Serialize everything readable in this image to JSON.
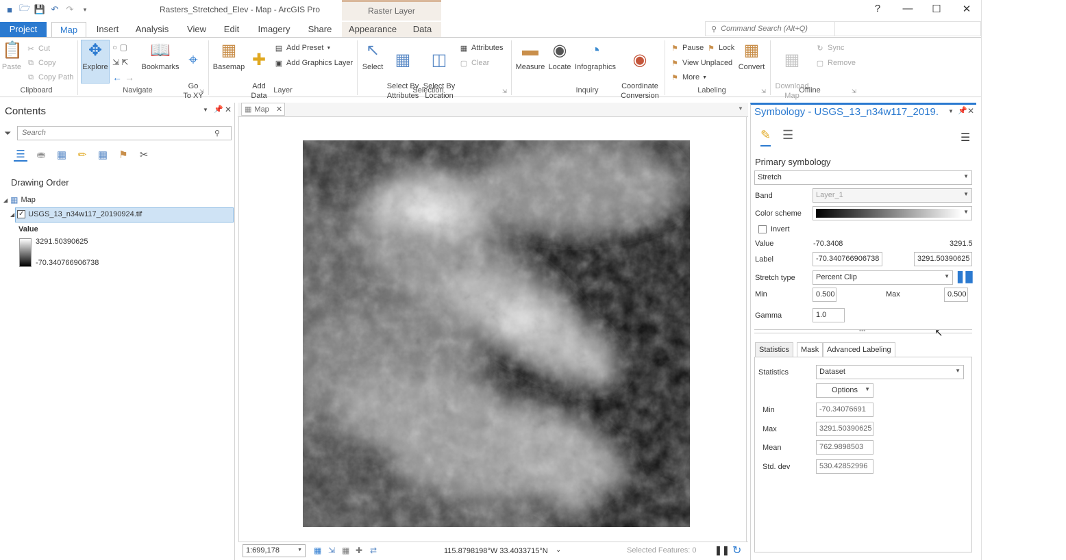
{
  "app": {
    "title": "Rasters_Stretched_Elev - Map - ArcGIS Pro",
    "context_tab_header": "Raster Layer",
    "help": "?",
    "command_search_placeholder": "Command Search (Alt+Q)"
  },
  "tabs": [
    "Project",
    "Map",
    "Insert",
    "Analysis",
    "View",
    "Edit",
    "Imagery",
    "Share",
    "Appearance",
    "Data"
  ],
  "ribbon": {
    "clipboard": {
      "label": "Clipboard",
      "paste": "Paste",
      "cut": "Cut",
      "copy": "Copy",
      "copy_path": "Copy Path"
    },
    "navigate": {
      "label": "Navigate",
      "explore": "Explore",
      "bookmarks": "Bookmarks",
      "go_to_xy": "Go\nTo XY"
    },
    "layer": {
      "label": "Layer",
      "basemap": "Basemap",
      "add_data": "Add\nData",
      "add_preset": "Add Preset",
      "add_graphics_layer": "Add Graphics Layer"
    },
    "selection": {
      "label": "Selection",
      "select": "Select",
      "select_by_attributes": "Select By\nAttributes",
      "select_by_location": "Select By\nLocation",
      "attributes": "Attributes",
      "clear": "Clear"
    },
    "inquiry": {
      "label": "Inquiry",
      "measure": "Measure",
      "locate": "Locate",
      "infographics": "Infographics",
      "coordinate_conversion": "Coordinate\nConversion"
    },
    "labeling": {
      "label": "Labeling",
      "pause": "Pause",
      "lock": "Lock",
      "view_unplaced": "View Unplaced",
      "more": "More",
      "convert": "Convert"
    },
    "offline": {
      "label": "Offline",
      "download_map": "Download\nMap",
      "sync": "Sync",
      "remove": "Remove"
    }
  },
  "contents": {
    "title": "Contents",
    "search_placeholder": "Search",
    "drawing_order": "Drawing Order",
    "map_name": "Map",
    "layer_name": "USGS_13_n34w117_20190924.tif",
    "legend_title": "Value",
    "legend_high": "3291.50390625",
    "legend_low": "-70.340766906738"
  },
  "map_view": {
    "tab_label": "Map",
    "scale": "1:699,178",
    "coordinates": "115.8798198°W 33.4033715°N",
    "selected_features": "Selected Features: 0"
  },
  "symbology": {
    "title": "Symbology - USGS_13_n34w117_2019...",
    "primary_symbology": "Primary symbology",
    "renderer": "Stretch",
    "band_label": "Band",
    "band_value": "Layer_1",
    "color_scheme_label": "Color scheme",
    "invert_label": "Invert",
    "value_label": "Value",
    "value_min": "-70.3408",
    "value_max": "3291.5",
    "label_label": "Label",
    "label_min": "-70.340766906738",
    "label_max": "3291.50390625",
    "stretch_type_label": "Stretch type",
    "stretch_type": "Percent Clip",
    "min_label": "Min",
    "min_value": "0.500",
    "max_label": "Max",
    "max_value": "0.500",
    "gamma_label": "Gamma",
    "gamma_value": "1.0",
    "tabs": [
      "Statistics",
      "Mask",
      "Advanced Labeling"
    ],
    "statistics_label": "Statistics",
    "statistics_value": "Dataset",
    "options_label": "Options",
    "stats": {
      "min_label": "Min",
      "min": "-70.34076691",
      "max_label": "Max",
      "max": "3291.50390625",
      "mean_label": "Mean",
      "mean": "762.9898503",
      "std_label": "Std. dev",
      "std": "530.42852996"
    }
  },
  "colors": {
    "accent": "#2b7ad0",
    "selection_bg": "#cfe3f5",
    "context_tab": "#f3eee8"
  }
}
